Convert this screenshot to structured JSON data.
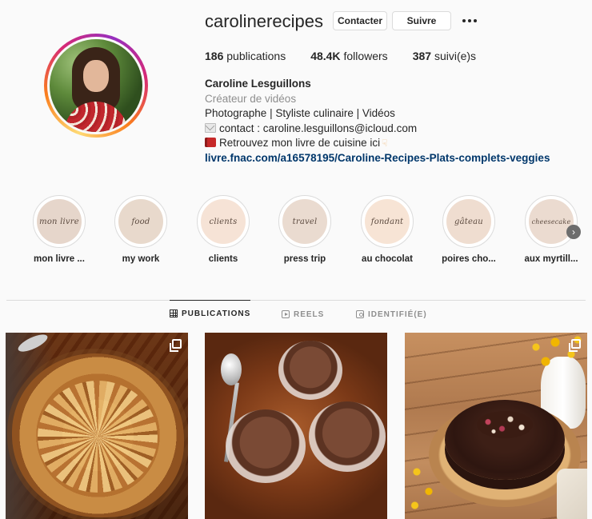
{
  "profile": {
    "username": "carolinerecipes",
    "buttons": {
      "contact": "Contacter",
      "follow": "Suivre"
    },
    "stats": [
      {
        "count": "186",
        "label": "publications"
      },
      {
        "count": "48.4K",
        "label": "followers"
      },
      {
        "count": "387",
        "label": "suivi(e)s"
      }
    ],
    "full_name": "Caroline Lesguillons",
    "category": "Créateur de vidéos",
    "bio_lines": [
      "Photographe | Styliste culinaire | Vidéos",
      "contact : caroline.lesguillons@icloud.com",
      "Retrouvez mon livre de cuisine ici"
    ],
    "link": "livre.fnac.com/a16578195/Caroline-Recipes-Plats-complets-veggies"
  },
  "highlights": [
    {
      "cover_text": "mon livre",
      "label": "mon livre ...",
      "color": "#e6d6cb"
    },
    {
      "cover_text": "food",
      "label": "my work",
      "color": "#e8d9cc"
    },
    {
      "cover_text": "clients",
      "label": "clients",
      "color": "#f6e3d6"
    },
    {
      "cover_text": "travel",
      "label": "press trip",
      "color": "#eadbd0"
    },
    {
      "cover_text": "fondant",
      "label": "au chocolat",
      "color": "#f7e4d5"
    },
    {
      "cover_text": "gâteau",
      "label": "poires cho...",
      "color": "#efddd0"
    },
    {
      "cover_text": "cheesecake",
      "label": "aux myrtill...",
      "color": "#ebdbd0"
    }
  ],
  "tabs": {
    "posts": "PUBLICATIONS",
    "reels": "REELS",
    "tagged": "IDENTIFIÉ(E)"
  },
  "posts": [
    {
      "name": "apple-galette",
      "multi": true
    },
    {
      "name": "chocolate-mousse",
      "multi": false
    },
    {
      "name": "chocolate-cake",
      "multi": true
    }
  ]
}
